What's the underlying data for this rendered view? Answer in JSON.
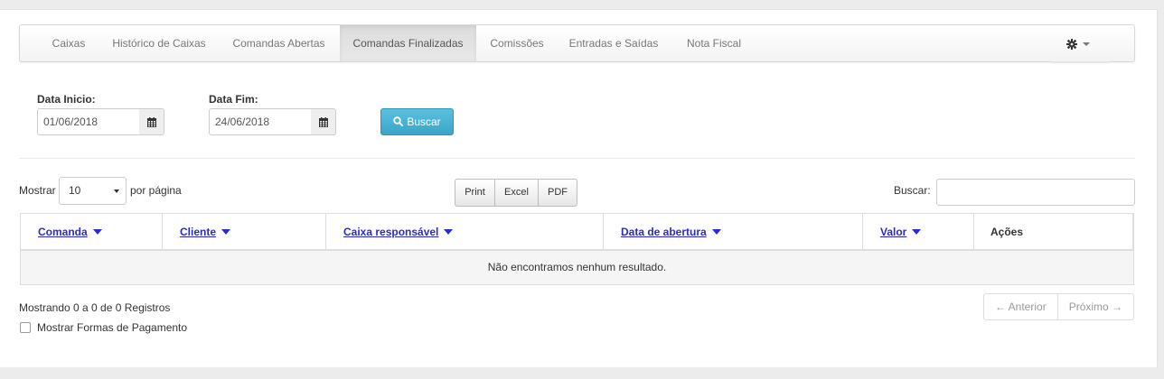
{
  "tabs": [
    {
      "label": "Caixas",
      "active": false
    },
    {
      "label": "Histórico de Caixas",
      "active": false
    },
    {
      "label": "Comandas Abertas",
      "active": false
    },
    {
      "label": "Comandas Finalizadas",
      "active": true
    },
    {
      "label": "Comissões",
      "active": false
    },
    {
      "label": "Entradas e Saídas",
      "active": false
    },
    {
      "label": "Nota Fiscal",
      "active": false
    }
  ],
  "settings_icon": "gear-icon",
  "filters": {
    "start_label": "Data Inicio:",
    "start_value": "01/06/2018",
    "end_label": "Data Fim:",
    "end_value": "24/06/2018",
    "calendar_icon": "calendar-icon",
    "search_button": "Buscar",
    "search_icon": "search-icon"
  },
  "table_controls": {
    "show_label": "Mostrar",
    "page_size": "10",
    "per_page_label": "por página",
    "export_buttons": [
      "Print",
      "Excel",
      "PDF"
    ],
    "search_label": "Buscar:",
    "search_value": ""
  },
  "table": {
    "columns": [
      {
        "label": "Comanda",
        "sortable": true
      },
      {
        "label": "Cliente",
        "sortable": true
      },
      {
        "label": "Caixa responsável",
        "sortable": true
      },
      {
        "label": "Data de abertura",
        "sortable": true
      },
      {
        "label": "Valor",
        "sortable": true
      },
      {
        "label": "Ações",
        "sortable": false
      }
    ],
    "empty_message": "Não encontramos nenhum resultado."
  },
  "footer": {
    "records_info": "Mostrando 0 a 0 de 0 Registros",
    "prev_label": "← Anterior",
    "next_label": "Próximo →",
    "payment_forms_label": "Mostrar Formas de Pagamento",
    "payment_forms_checked": false
  },
  "colors": {
    "accent": "#5bc0de",
    "link": "#2a2ad4"
  }
}
